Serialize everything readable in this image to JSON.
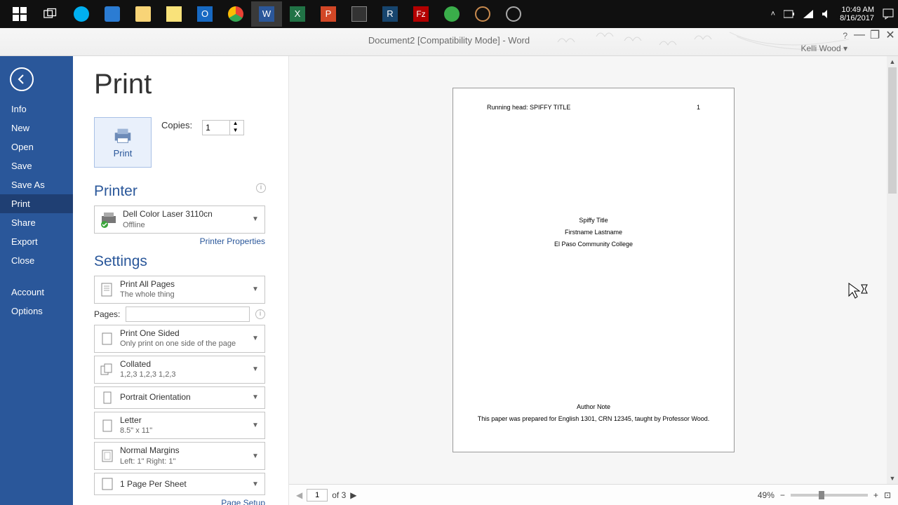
{
  "taskbar": {
    "time": "10:49 AM",
    "date": "8/16/2017"
  },
  "window": {
    "title": "Document2 [Compatibility Mode] - Word",
    "user": "Kelli Wood ▾"
  },
  "sidebar": {
    "items": [
      "Info",
      "New",
      "Open",
      "Save",
      "Save As",
      "Print",
      "Share",
      "Export",
      "Close"
    ],
    "items2": [
      "Account",
      "Options"
    ],
    "selected_index": 5
  },
  "print": {
    "heading": "Print",
    "button_label": "Print",
    "copies_label": "Copies:",
    "copies_value": "1"
  },
  "printer": {
    "heading": "Printer",
    "name": "Dell Color Laser 3110cn",
    "status": "Offline",
    "properties_link": "Printer Properties"
  },
  "settings": {
    "heading": "Settings",
    "pages_label": "Pages:",
    "pages_value": "",
    "page_setup_link": "Page Setup",
    "range": {
      "title": "Print All Pages",
      "sub": "The whole thing"
    },
    "sides": {
      "title": "Print One Sided",
      "sub": "Only print on one side of the page"
    },
    "collate": {
      "title": "Collated",
      "sub": "1,2,3    1,2,3    1,2,3"
    },
    "orient": {
      "title": "Portrait Orientation",
      "sub": ""
    },
    "paper": {
      "title": "Letter",
      "sub": "8.5\" x 11\""
    },
    "margins": {
      "title": "Normal Margins",
      "sub": "Left:  1\"    Right:  1\""
    },
    "sheet": {
      "title": "1 Page Per Sheet",
      "sub": ""
    }
  },
  "preview": {
    "running_head": "Running head: SPIFFY TITLE",
    "page_num": "1",
    "title": "Spiffy Title",
    "author": "Firstname Lastname",
    "school": "El Paso Community College",
    "note_head": "Author Note",
    "note_body": "This paper was prepared for English 1301, CRN 12345, taught by Professor Wood."
  },
  "footer": {
    "page_input": "1",
    "page_total": "of 3",
    "zoom_pct": "49%"
  }
}
